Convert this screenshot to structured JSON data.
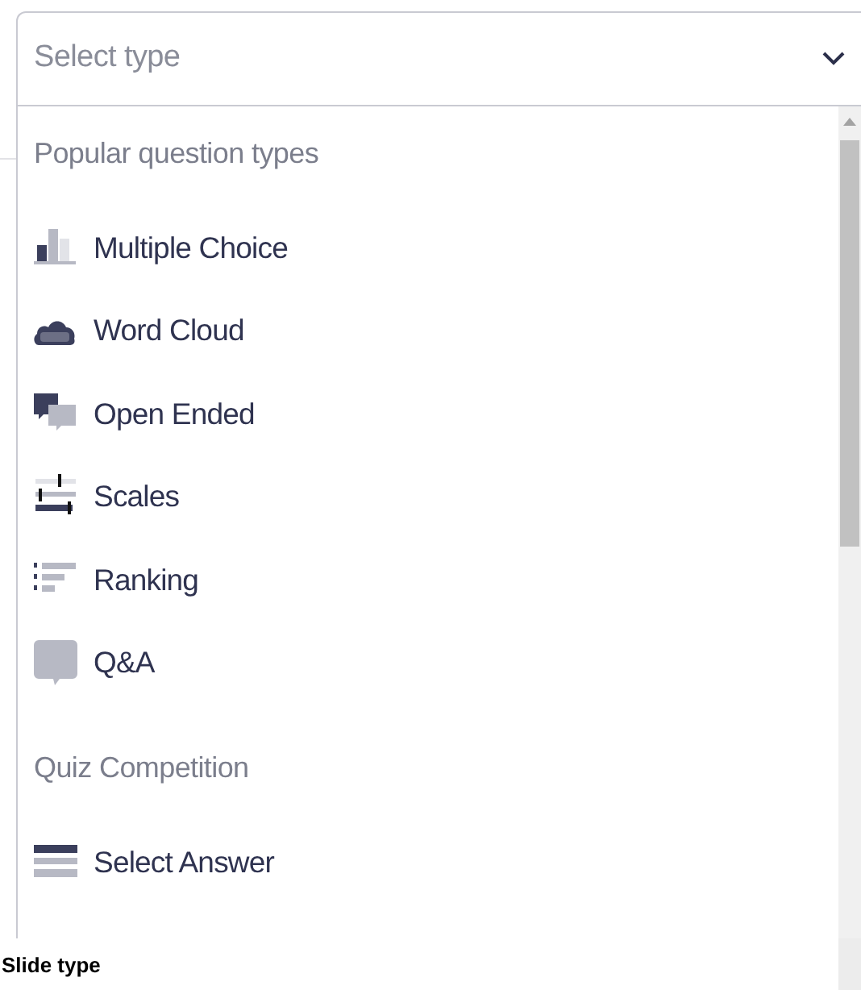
{
  "select": {
    "placeholder": "Select type"
  },
  "groups": [
    {
      "heading": "Popular question types",
      "items": [
        {
          "label": "Multiple Choice",
          "kind": "bars"
        },
        {
          "label": "Word Cloud",
          "kind": "cloud"
        },
        {
          "label": "Open Ended",
          "kind": "bubbles"
        },
        {
          "label": "Scales",
          "kind": "sliders"
        },
        {
          "label": "Ranking",
          "kind": "ranking"
        },
        {
          "label": "Q&A",
          "kind": "speech"
        }
      ]
    },
    {
      "heading": "Quiz Competition",
      "items": [
        {
          "label": "Select Answer",
          "kind": "lines"
        }
      ]
    }
  ],
  "field_label": "Slide type"
}
